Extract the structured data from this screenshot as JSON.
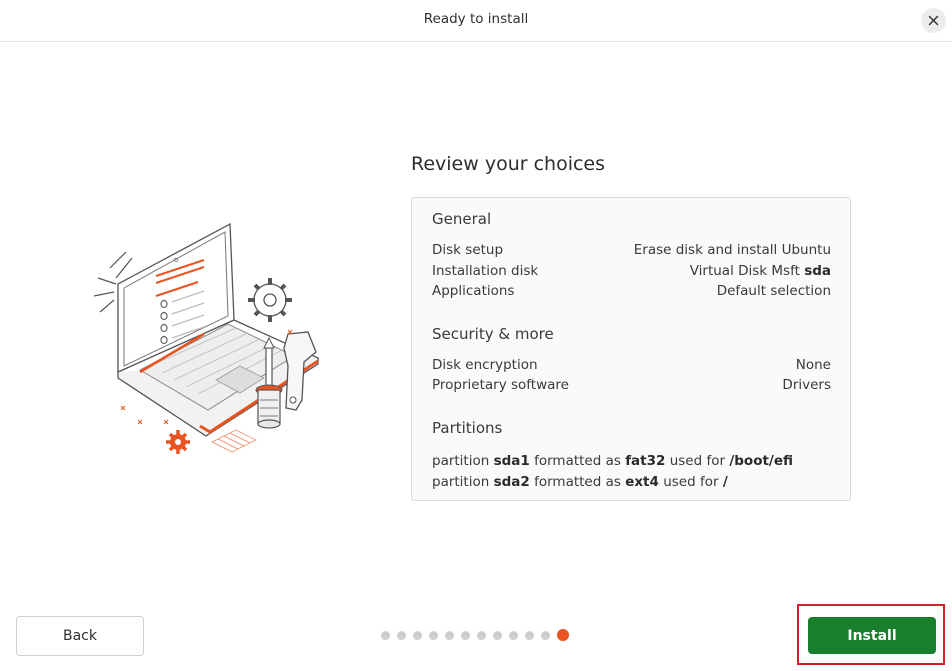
{
  "window": {
    "title": "Ready to install"
  },
  "icons": {
    "close": "close-icon",
    "illustration": "laptop-tools-illustration"
  },
  "main": {
    "heading": "Review your choices",
    "general": {
      "title": "General",
      "rows": [
        {
          "label": "Disk setup",
          "value": "Erase disk and install Ubuntu"
        },
        {
          "label": "Installation disk",
          "value_prefix": "Virtual Disk Msft ",
          "value_bold": "sda"
        },
        {
          "label": "Applications",
          "value": "Default selection"
        }
      ]
    },
    "security": {
      "title": "Security & more",
      "rows": [
        {
          "label": "Disk encryption",
          "value": "None"
        },
        {
          "label": "Proprietary software",
          "value": "Drivers"
        }
      ]
    },
    "partitions": {
      "title": "Partitions",
      "lines": [
        {
          "t1": "partition ",
          "name": "sda1",
          "t2": " formatted as ",
          "fs": "fat32",
          "t3": " used for ",
          "mount": "/boot/efi"
        },
        {
          "t1": "partition ",
          "name": "sda2",
          "t2": " formatted as ",
          "fs": "ext4",
          "t3": " used for ",
          "mount": "/"
        }
      ]
    }
  },
  "footer": {
    "back_label": "Back",
    "install_label": "Install",
    "progress": {
      "total_steps": 12,
      "current_step": 12
    }
  },
  "colors": {
    "accent": "#e95420",
    "install_button": "#1a7f2c",
    "highlight_frame": "#d0202a"
  }
}
